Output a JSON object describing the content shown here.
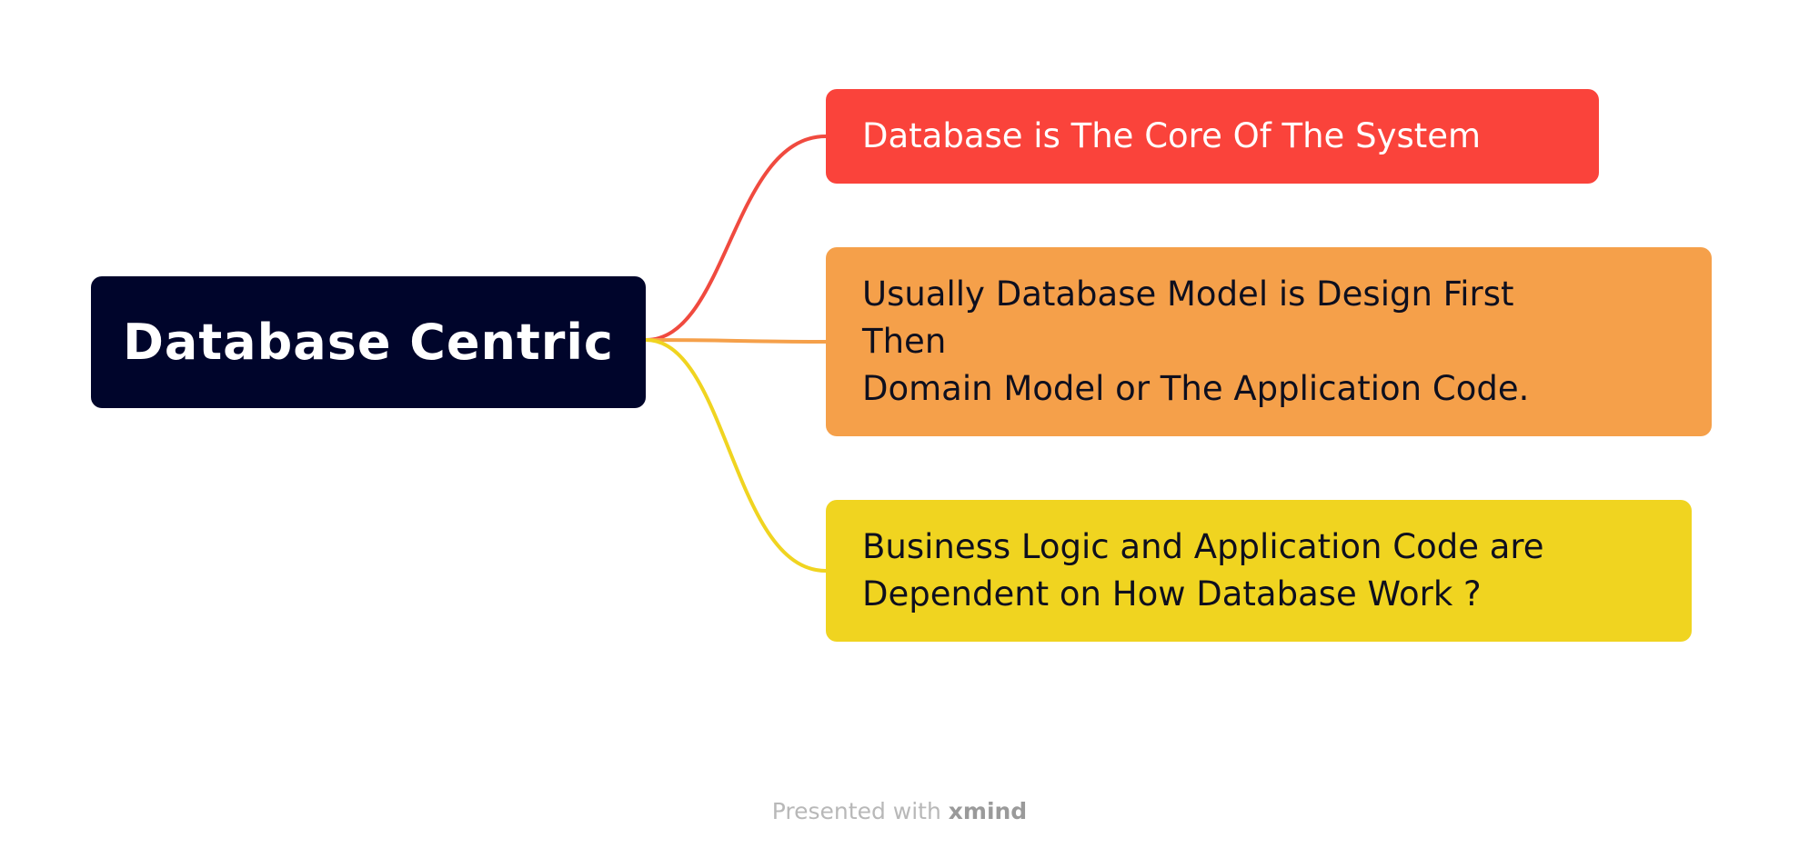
{
  "root": {
    "label": "Database Centric",
    "color": "#00052b"
  },
  "topics": [
    {
      "lines": [
        "Database is The Core Of The System"
      ],
      "color": "#fa433b"
    },
    {
      "lines": [
        "Usually Database Model is Design First",
        "Then",
        "Domain Model or The Application Code."
      ],
      "color": "#f5a04a"
    },
    {
      "lines": [
        "Business Logic and Application Code are",
        "Dependent on How Database Work ?"
      ],
      "color": "#f0d420"
    }
  ],
  "footer": {
    "prefix": "Presented with ",
    "brand": "xmind"
  }
}
